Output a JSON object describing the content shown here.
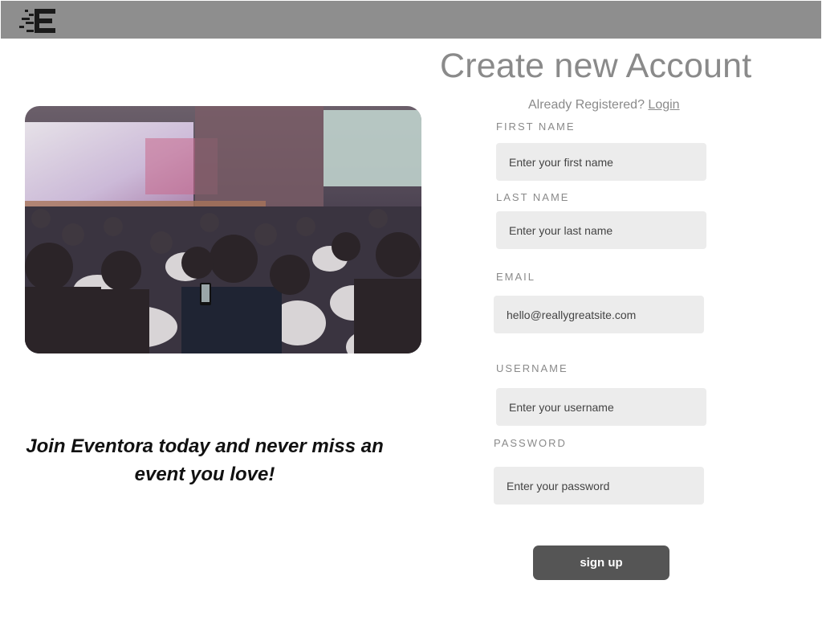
{
  "header": {
    "logo_icon": "eventora-logo-icon"
  },
  "hero": {
    "image": "conference-audience-photo"
  },
  "tagline": "Join Eventora today and never miss an event you love!",
  "form": {
    "title": "Create new Account",
    "already_text": "Already Registered?",
    "login_link": "Login",
    "first_name": {
      "label": "FIRST NAME",
      "placeholder": "Enter your first name",
      "value": ""
    },
    "last_name": {
      "label": "LAST NAME",
      "placeholder": "Enter your last name",
      "value": ""
    },
    "email": {
      "label": "EMAIL",
      "placeholder": "",
      "value": "hello@reallygreatsite.com"
    },
    "username": {
      "label": "USERNAME",
      "placeholder": "Enter your username",
      "value": ""
    },
    "password": {
      "label": "PASSWORD",
      "placeholder": "Enter your password",
      "value": ""
    },
    "submit_label": "sign up"
  },
  "colors": {
    "header_bg": "#8e8e8e",
    "field_bg": "#ececec",
    "button_bg": "#555555",
    "muted_text": "#8a8a8a"
  }
}
